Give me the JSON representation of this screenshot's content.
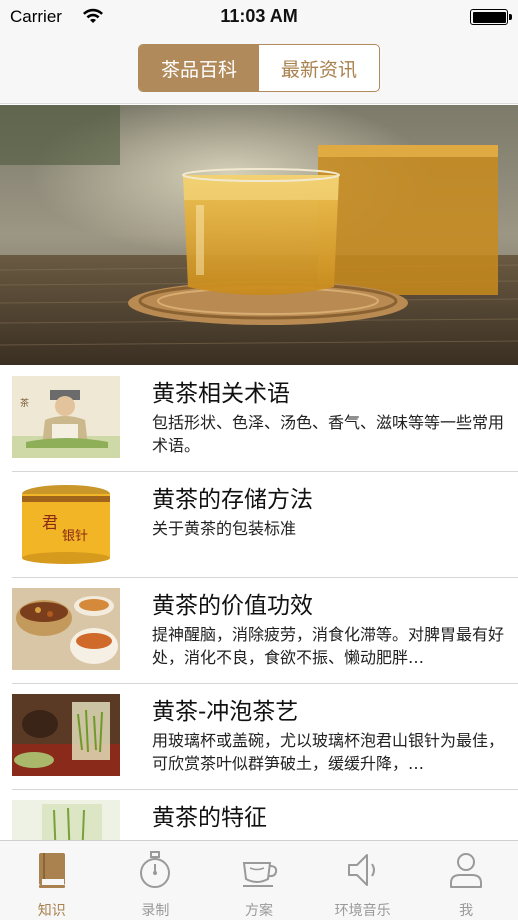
{
  "status_bar": {
    "carrier": "Carrier",
    "time": "11:03 AM"
  },
  "nav": {
    "segments": [
      {
        "label": "茶品百科",
        "active": true
      },
      {
        "label": "最新资讯",
        "active": false
      }
    ]
  },
  "banner": {
    "image": "tea-glass-photo"
  },
  "list": [
    {
      "title": "黄茶相关术语",
      "desc": "包括形状、色泽、汤色、香气、滋味等等一些常用术语。"
    },
    {
      "title": "黄茶的存储方法",
      "desc": "关于黄茶的包装标准"
    },
    {
      "title": "黄茶的价值功效",
      "desc": "提神醒脑，消除疲劳，消食化滞等。对脾胃最有好处，消化不良，食欲不振、懒动肥胖…"
    },
    {
      "title": "黄茶-冲泡茶艺",
      "desc": "用玻璃杯或盖碗，尤以玻璃杯泡君山银针为最佳，可欣赏茶叶似群笋破土，缓缓升降，…"
    },
    {
      "title": "黄茶的特征",
      "desc": ""
    }
  ],
  "tabs": [
    {
      "label": "知识",
      "icon": "book-icon",
      "active": true
    },
    {
      "label": "录制",
      "icon": "stopwatch-icon",
      "active": false
    },
    {
      "label": "方案",
      "icon": "teacup-icon",
      "active": false
    },
    {
      "label": "环境音乐",
      "icon": "speaker-icon",
      "active": false
    },
    {
      "label": "我",
      "icon": "person-icon",
      "active": false
    }
  ],
  "colors": {
    "accent": "#b08a5a",
    "tab_inactive": "#9a9a9a"
  }
}
